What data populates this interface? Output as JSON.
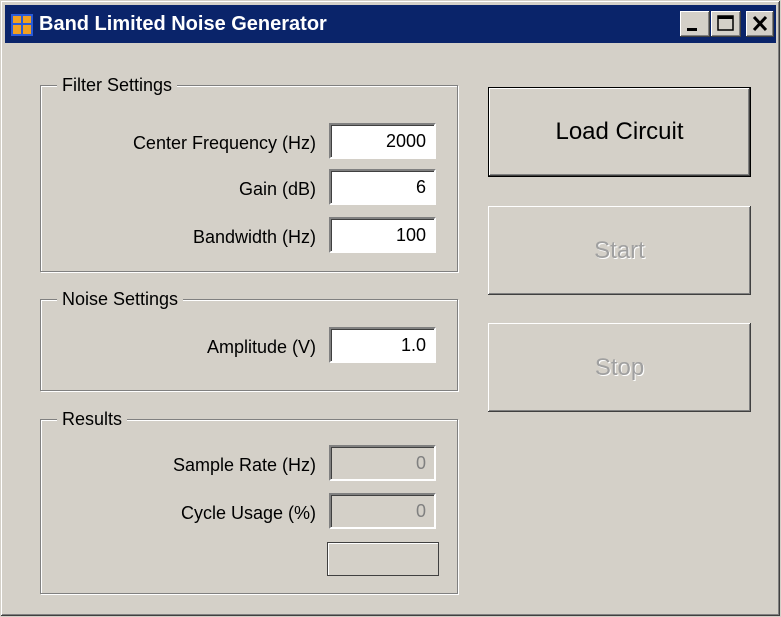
{
  "window": {
    "title": "Band Limited Noise Generator"
  },
  "filter_settings": {
    "label": "Filter Settings",
    "center_frequency": {
      "label": "Center Frequency (Hz)",
      "value": "2000"
    },
    "gain": {
      "label": "Gain (dB)",
      "value": "6"
    },
    "bandwidth": {
      "label": "Bandwidth (Hz)",
      "value": "100"
    }
  },
  "noise_settings": {
    "label": "Noise Settings",
    "amplitude": {
      "label": "Amplitude (V)",
      "value": "1.0"
    }
  },
  "results": {
    "label": "Results",
    "sample_rate": {
      "label": "Sample Rate (Hz)",
      "value": "0"
    },
    "cycle_usage": {
      "label": "Cycle Usage (%)",
      "value": "0"
    }
  },
  "buttons": {
    "load": "Load Circuit",
    "start": "Start",
    "stop": "Stop"
  },
  "icons": {
    "app": "form-icon",
    "minimize": "minimize-icon",
    "maximize": "maximize-icon",
    "close": "close-icon"
  },
  "colors": {
    "titlebar": "#0a246a",
    "window_bg": "#d4d0c8",
    "disabled_text": "#a0a0a0"
  }
}
